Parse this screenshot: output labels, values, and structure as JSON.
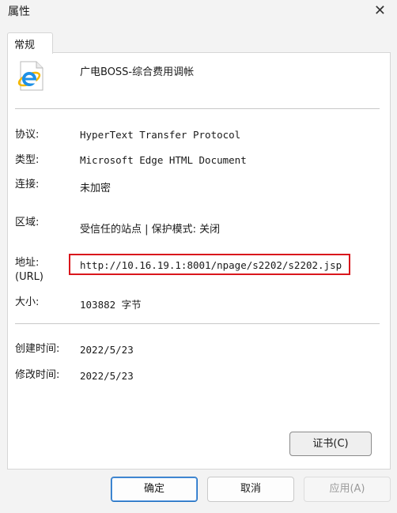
{
  "window": {
    "title": "属性",
    "close_icon": "✕"
  },
  "tabs": [
    {
      "label": "常规"
    }
  ],
  "document": {
    "title": "广电BOSS-综合费用调帐",
    "icon": "ie-document-icon"
  },
  "fields": {
    "protocol": {
      "label": "协议:",
      "value": "HyperText Transfer Protocol"
    },
    "type": {
      "label": "类型:",
      "value": "Microsoft Edge HTML Document"
    },
    "connection": {
      "label": "连接:",
      "value": "未加密"
    },
    "zone": {
      "label": "区域:",
      "value": "受信任的站点 | 保护模式: 关闭"
    },
    "address": {
      "label": "地址:",
      "label2": "(URL)",
      "value": "http://10.16.19.1:8001/npage/s2202/s2202.jsp"
    },
    "size": {
      "label": "大小:",
      "value": "103882 字节"
    },
    "created": {
      "label": "创建时间:",
      "value": "2022/5/23"
    },
    "modified": {
      "label": "修改时间:",
      "value": "2022/5/23"
    }
  },
  "buttons": {
    "certificate": "证书(C)",
    "ok": "确定",
    "cancel": "取消",
    "apply": "应用(A)"
  },
  "colors": {
    "highlight_border": "#d9161c",
    "ie_blue": "#1e90e6",
    "ie_gold": "#f5b800"
  }
}
